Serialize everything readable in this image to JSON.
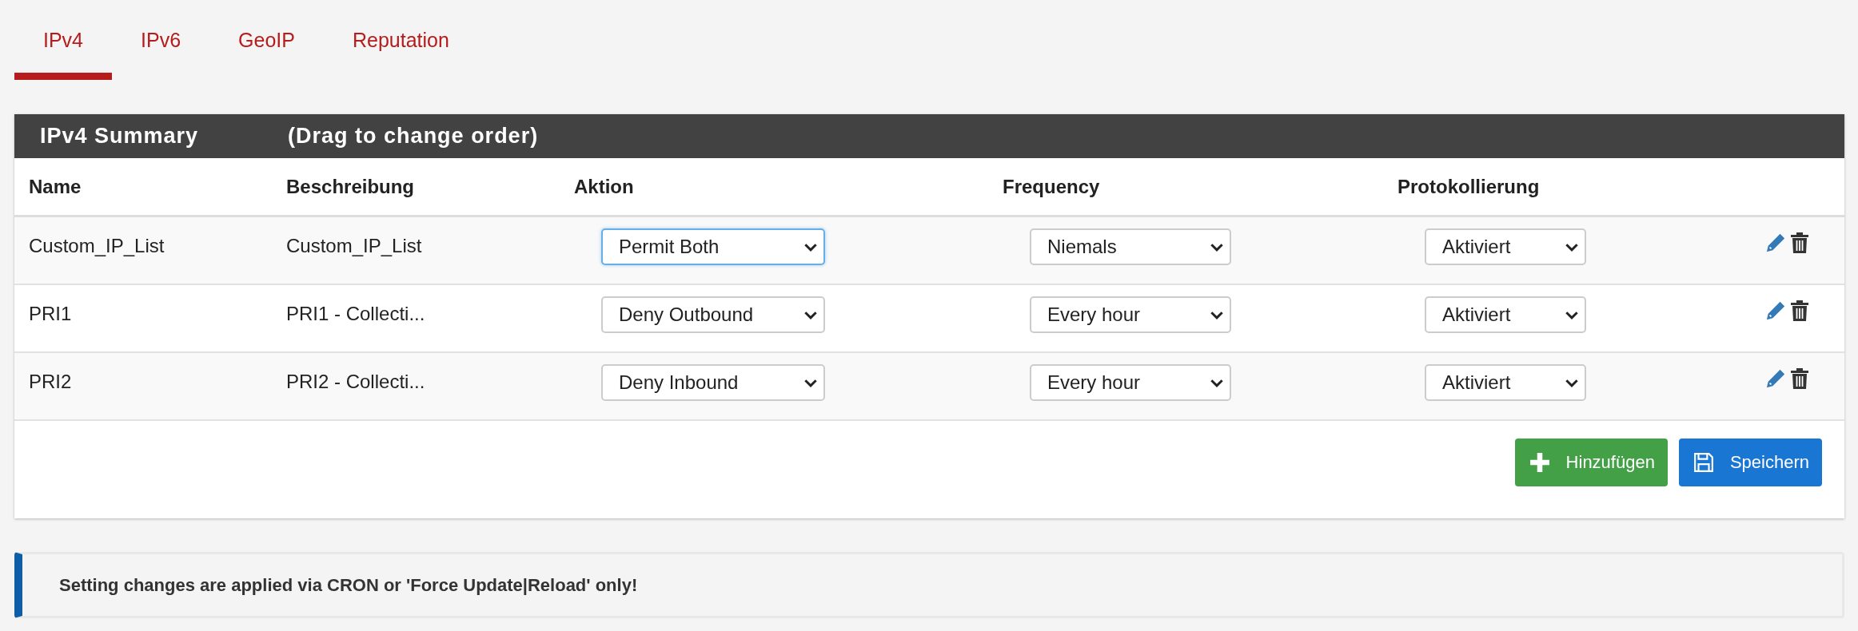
{
  "tabs": [
    {
      "label": "IPv4",
      "selected": true
    },
    {
      "label": "IPv6",
      "selected": false
    },
    {
      "label": "GeoIP",
      "selected": false
    },
    {
      "label": "Reputation",
      "selected": false
    }
  ],
  "panel": {
    "title": "IPv4 Summary",
    "subtitle": "(Drag to change order)"
  },
  "table": {
    "columns": [
      "Name",
      "Beschreibung",
      "Aktion",
      "Frequency",
      "Protokollierung"
    ],
    "rows": [
      {
        "name": "Custom_IP_List",
        "description": "Custom_IP_List",
        "action": {
          "value": "Permit Both",
          "focused": true
        },
        "frequency": {
          "value": "Niemals",
          "focused": false
        },
        "logging": {
          "value": "Aktiviert",
          "focused": false
        }
      },
      {
        "name": "PRI1",
        "description": "PRI1 - Collecti...",
        "action": {
          "value": "Deny Outbound",
          "focused": false
        },
        "frequency": {
          "value": "Every hour",
          "focused": false
        },
        "logging": {
          "value": "Aktiviert",
          "focused": false
        }
      },
      {
        "name": "PRI2",
        "description": "PRI2 - Collecti...",
        "action": {
          "value": "Deny Inbound",
          "focused": false
        },
        "frequency": {
          "value": "Every hour",
          "focused": false
        },
        "logging": {
          "value": "Aktiviert",
          "focused": false
        }
      }
    ]
  },
  "buttons": [
    {
      "label": "Hinzufügen",
      "kind": "add"
    },
    {
      "label": "Speichern",
      "kind": "save"
    }
  ],
  "notice": "Setting changes are applied via CRON or 'Force Update|Reload' only!"
}
